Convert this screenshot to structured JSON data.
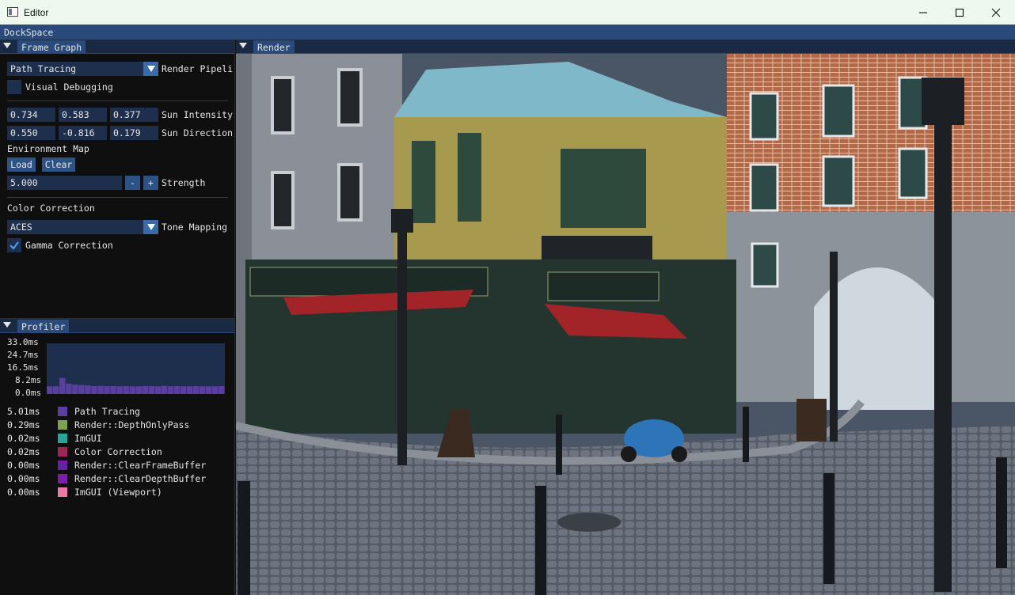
{
  "window": {
    "title": "Editor"
  },
  "dockspace": {
    "label": "DockSpace"
  },
  "frame_graph": {
    "tab": "Frame Graph",
    "render_pipeline": {
      "value": "Path Tracing",
      "label": "Render Pipeli"
    },
    "visual_debugging": {
      "label": "Visual Debugging",
      "checked": false
    },
    "sun_intensity": {
      "values": [
        "0.734",
        "0.583",
        "0.377"
      ],
      "label": "Sun Intensity"
    },
    "sun_direction": {
      "values": [
        "0.550",
        "-0.816",
        "0.179"
      ],
      "label": "Sun Direction"
    },
    "environment_map": {
      "label": "Environment Map",
      "load": "Load",
      "clear": "Clear"
    },
    "strength": {
      "value": "5.000",
      "minus": "-",
      "plus": "+",
      "label": "Strength"
    },
    "color_correction": {
      "label": "Color Correction"
    },
    "tone_mapping": {
      "value": "ACES",
      "label": "Tone Mapping"
    },
    "gamma_correction": {
      "label": "Gamma Correction",
      "checked": true
    }
  },
  "profiler": {
    "tab": "Profiler",
    "y_ticks": [
      "33.0ms",
      "24.7ms",
      "16.5ms",
      "8.2ms",
      "0.0ms"
    ],
    "chart_data": {
      "type": "area",
      "ylim": [
        0,
        33.0
      ],
      "series": [
        {
          "name": "Path Tracing",
          "color": "#5b3fa0",
          "values": [
            5.0,
            5.0,
            10.5,
            6.8,
            6.2,
            5.9,
            5.6,
            5.2,
            5.3,
            5.1,
            5.2,
            5.0,
            5.1,
            5.0,
            5.0,
            5.2,
            5.1,
            5.0,
            5.3,
            5.0,
            5.1,
            5.0,
            5.0,
            5.1,
            5.0,
            5.0,
            5.0,
            5.1
          ]
        }
      ]
    },
    "entries": [
      {
        "ms": "5.01ms",
        "name": "Path Tracing",
        "color": "#5b3fa0"
      },
      {
        "ms": "0.29ms",
        "name": "Render::DepthOnlyPass",
        "color": "#7fa24c"
      },
      {
        "ms": "0.02ms",
        "name": "ImGUI",
        "color": "#2aa39a"
      },
      {
        "ms": "0.02ms",
        "name": "Color Correction",
        "color": "#a0235a"
      },
      {
        "ms": "0.00ms",
        "name": "Render::ClearFrameBuffer",
        "color": "#6a1fa8"
      },
      {
        "ms": "0.00ms",
        "name": "Render::ClearDepthBuffer",
        "color": "#7a1fa8"
      },
      {
        "ms": "0.00ms",
        "name": "ImGUI (Viewport)",
        "color": "#e87aa3"
      }
    ]
  },
  "render": {
    "tab": "Render"
  }
}
